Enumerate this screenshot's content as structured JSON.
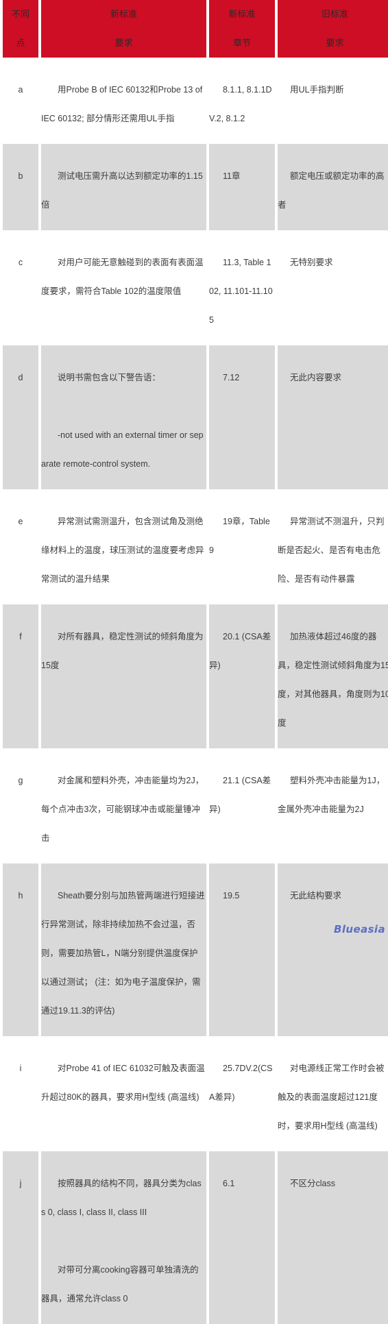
{
  "table": {
    "headers": {
      "id": [
        "不同",
        "点"
      ],
      "new_requirement": [
        "新标准",
        "要求"
      ],
      "new_clause": [
        "新标准",
        "章节"
      ],
      "old_requirement": [
        "旧标准",
        "要求"
      ]
    },
    "colors": {
      "header_bg": "#CE0E24",
      "header_text": "#2a2a2a",
      "row_gray_bg": "#d9d9d9",
      "row_white_bg": "#ffffff",
      "body_text": "#3c3c3c",
      "watermark": "#5b6fc4"
    },
    "rows": [
      {
        "id": "a",
        "new_requirement": [
          "用Probe B of IEC 60132和Probe 13 of IEC 60132; 部分情形还需用UL手指"
        ],
        "new_clause": [
          "8.1.1, 8.1.1DV.2, 8.1.2"
        ],
        "old_requirement": [
          "用UL手指判断"
        ],
        "shade": "white"
      },
      {
        "id": "b",
        "new_requirement": [
          "测试电压需升高以达到额定功率的1.15倍"
        ],
        "new_clause": [
          "11章"
        ],
        "old_requirement": [
          "额定电压或额定功率的高者"
        ],
        "shade": "gray"
      },
      {
        "id": "c",
        "new_requirement": [
          "对用户可能无意触碰到的表面有表面温度要求，需符合Table 102的温度限值"
        ],
        "new_clause": [
          "11.3, Table 102, 11.101-11.105"
        ],
        "old_requirement": [
          "无特别要求"
        ],
        "shade": "white"
      },
      {
        "id": "d",
        "new_requirement": [
          "说明书需包含以下警告语：",
          "-not used with an external timer or separate remote-control system."
        ],
        "new_clause": [
          "7.12"
        ],
        "old_requirement": [
          "无此内容要求"
        ],
        "shade": "gray"
      },
      {
        "id": "e",
        "new_requirement": [
          "异常测试需测温升，包含测试角及测绝缘材料上的温度，球压测试的温度要考虑异常测试的温升结果"
        ],
        "new_clause": [
          "19章，Table 9"
        ],
        "old_requirement": [
          "异常测试不测温升，只判断是否起火、是否有电击危险、是否有动件暴露"
        ],
        "shade": "white"
      },
      {
        "id": "f",
        "new_requirement": [
          "对所有器具，稳定性测试的倾斜角度为15度"
        ],
        "new_clause": [
          "20.1 (CSA差异)"
        ],
        "old_requirement": [
          "加热液体超过46度的器具，稳定性测试倾斜角度为15度，对其他器具，角度则为10度"
        ],
        "shade": "gray"
      },
      {
        "id": "g",
        "new_requirement": [
          "对金属和塑料外壳，冲击能量均为2J，每个点冲击3次，可能钢球冲击或能量锤冲击"
        ],
        "new_clause": [
          "21.1 (CSA差异)"
        ],
        "old_requirement": [
          "塑料外壳冲击能量为1J，金属外壳冲击能量为2J"
        ],
        "shade": "white"
      },
      {
        "id": "h",
        "new_requirement": [
          "Sheath要分别与加热管两端进行短接进行异常测试，除非持续加热不会过温，否则，需要加热管L，N端分别提供温度保护以通过测试； (注：如为电子温度保护，需通过19.11.3的评估)"
        ],
        "new_clause": [
          "19.5"
        ],
        "old_requirement": [
          "无此结构要求"
        ],
        "shade": "gray"
      },
      {
        "id": "i",
        "new_requirement": [
          "对Probe 41 of IEC 61032可触及表面温升超过80K的器具，要求用H型线 (高温线)"
        ],
        "new_clause": [
          "25.7DV.2(CSA差异)"
        ],
        "old_requirement": [
          "对电源线正常工作时会被触及的表面温度超过121度时，要求用H型线 (高温线)"
        ],
        "shade": "white"
      },
      {
        "id": "j",
        "new_requirement": [
          "按照器具的结构不同，器具分类为class 0, class I, class II, class III",
          "对带可分离cooking容器可单独清洗的器具，通常允许class 0"
        ],
        "new_clause": [
          "6.1"
        ],
        "old_requirement": [
          "不区分class"
        ],
        "shade": "gray"
      }
    ]
  },
  "watermark": {
    "text": "Blueasia"
  }
}
